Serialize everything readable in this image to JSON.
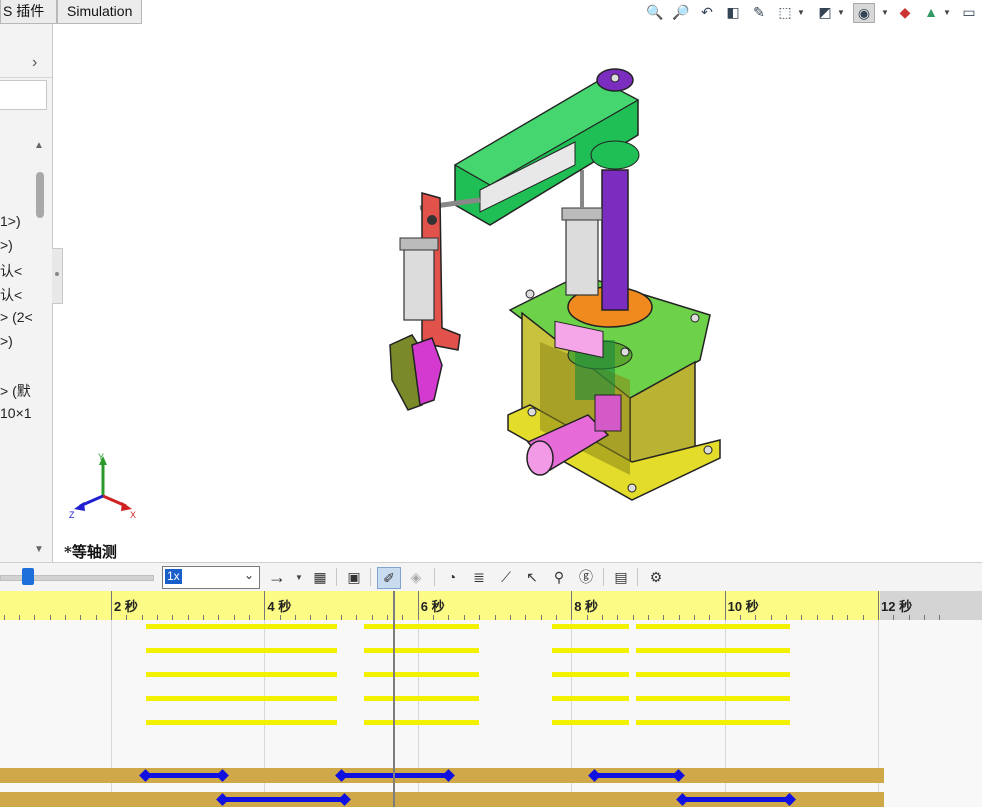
{
  "tabs": [
    {
      "label": "S 插件"
    },
    {
      "label": "Simulation"
    }
  ],
  "feature_tree": {
    "partial_items": [
      "1>)",
      ">)",
      "认<",
      "认<",
      "> (2<",
      ">)",
      "> (默",
      "10×1"
    ]
  },
  "toolbar_icons": [
    "zoom-to-fit-icon",
    "zoom-to-area-icon",
    "previous-view-icon",
    "section-view-icon",
    "dynamic-annotation-icon",
    "view-orientation-icon",
    "display-style-icon",
    "hide-show-items-icon",
    "edit-appearance-icon",
    "apply-scene-icon",
    "view-settings-icon"
  ],
  "viewport": {
    "view_label": "*等轴测",
    "triad": {
      "x": "X",
      "y": "Y",
      "z": "Z"
    }
  },
  "motion_toolbar": {
    "playback_speed": "1x",
    "icons": [
      "play-icon",
      "save-animation-icon",
      "animation-wizard-icon",
      "autokey-icon",
      "add-key-icon",
      "motor-icon",
      "spring-icon",
      "contact-icon",
      "gravity-icon",
      "results-icon",
      "motion-study-properties-icon"
    ]
  },
  "timeline": {
    "labels": [
      "2 秒",
      "4 秒",
      "6 秒",
      "8 秒",
      "10 秒",
      "12 秒"
    ],
    "playhead_seconds": 5.0,
    "key_rows": [
      {
        "segments": [
          [
            2.45,
            4.95
          ],
          [
            5.3,
            6.8
          ],
          [
            7.75,
            8.75
          ],
          [
            8.85,
            10.85
          ]
        ]
      },
      {
        "segments": [
          [
            2.45,
            4.95
          ],
          [
            5.3,
            6.8
          ],
          [
            7.75,
            8.75
          ],
          [
            8.85,
            10.85
          ]
        ]
      },
      {
        "segments": [
          [
            2.45,
            4.95
          ],
          [
            5.3,
            6.8
          ],
          [
            7.75,
            8.75
          ],
          [
            8.85,
            10.85
          ]
        ]
      },
      {
        "segments": [
          [
            2.45,
            4.95
          ],
          [
            5.3,
            6.8
          ],
          [
            7.75,
            8.75
          ],
          [
            8.85,
            10.85
          ]
        ]
      },
      {
        "segments": [
          [
            2.45,
            4.95
          ],
          [
            5.3,
            6.8
          ],
          [
            7.75,
            8.75
          ],
          [
            8.85,
            10.85
          ]
        ]
      }
    ],
    "motor_rows": [
      {
        "segments": [
          [
            2.45,
            3.45
          ],
          [
            5.0,
            6.4
          ],
          [
            8.3,
            9.4
          ]
        ]
      },
      {
        "segments": [
          [
            3.45,
            5.05
          ],
          [
            9.45,
            10.85
          ]
        ],
        "extra_keys": [
          10.85
        ]
      }
    ]
  },
  "colors": {
    "arm": "#1fbf55",
    "base_box": "#c9c23c",
    "column": "#7a2dbf",
    "gripper_bracket": "#e0524a",
    "motor": "#e66bd8",
    "timeline_ruler": "#fbfb86",
    "key_bar": "#f2f200",
    "motor_bar": "#cfa84a",
    "key_segment": "#1010e0"
  }
}
